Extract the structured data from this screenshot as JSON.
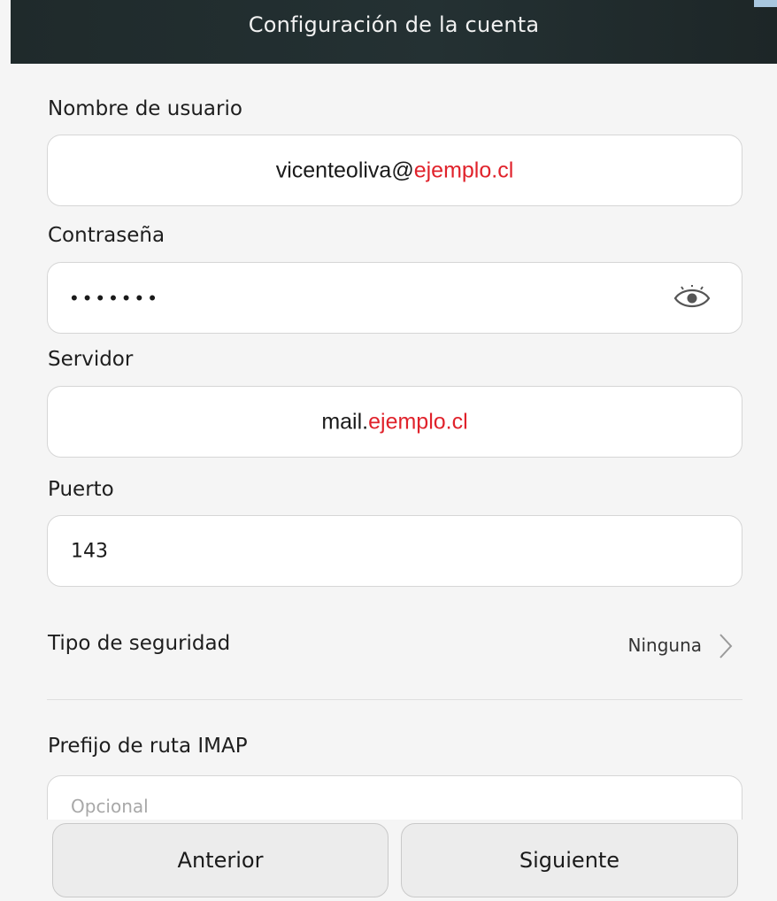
{
  "header": {
    "title": "Configuración de la cuenta"
  },
  "form": {
    "username": {
      "label": "Nombre de usuario",
      "value_user": "vicenteoliva@",
      "value_domain": "ejemplo.cl"
    },
    "password": {
      "label": "Contraseña",
      "masked_value": "•••••••",
      "toggle_icon": "eye-icon"
    },
    "server": {
      "label": "Servidor",
      "value_host": "mail.",
      "value_domain": "ejemplo.cl"
    },
    "port": {
      "label": "Puerto",
      "value": "143"
    },
    "security": {
      "label": "Tipo de seguridad",
      "value": "Ninguna",
      "icon": "chevron-right-icon"
    },
    "imap_prefix": {
      "label": "Prefijo de ruta IMAP",
      "placeholder": "Opcional"
    }
  },
  "buttons": {
    "previous": "Anterior",
    "next": "Siguiente"
  },
  "colors": {
    "domain_highlight": "#e0222b",
    "header_bg": "#243133",
    "page_bg": "#f5f5f5"
  }
}
